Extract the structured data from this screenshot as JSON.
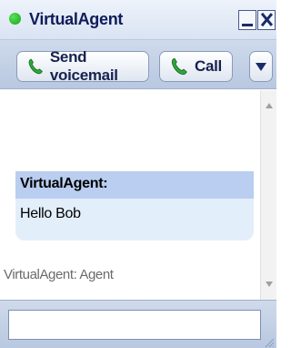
{
  "window": {
    "title": "VirtualAgent",
    "status": "online",
    "status_color": "#1fbf23",
    "controls": [
      "minimize-icon",
      "close-icon"
    ]
  },
  "toolbar": {
    "send_voicemail_label": "Send voicemail",
    "call_label": "Call",
    "icon": "phone-icon",
    "more_icon": "dropdown-arrow-icon"
  },
  "chat": {
    "message": {
      "sender": "VirtualAgent:",
      "text": "Hello Bob"
    },
    "system_message": "VirtualAgent: Agent"
  },
  "input": {
    "value": "",
    "placeholder": ""
  },
  "colors": {
    "title_text": "#0f1c5a",
    "accent": "#b9cef0",
    "message_bg": "#e3eefb"
  }
}
